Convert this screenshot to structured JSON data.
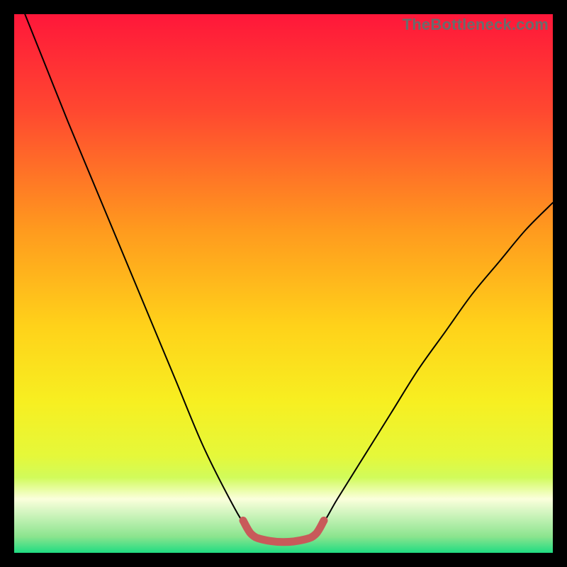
{
  "watermark": "TheBottleneck.com",
  "chart_data": {
    "type": "line",
    "title": "",
    "xlabel": "",
    "ylabel": "",
    "xlim": [
      0,
      100
    ],
    "ylim": [
      0,
      100
    ],
    "background_gradient": {
      "stops": [
        {
          "offset": 0.0,
          "color": "#ff173a"
        },
        {
          "offset": 0.18,
          "color": "#ff4830"
        },
        {
          "offset": 0.4,
          "color": "#ff9a1e"
        },
        {
          "offset": 0.58,
          "color": "#ffd21a"
        },
        {
          "offset": 0.72,
          "color": "#f7ef21"
        },
        {
          "offset": 0.82,
          "color": "#e5f83a"
        },
        {
          "offset": 0.86,
          "color": "#d1fb5a"
        },
        {
          "offset": 0.9,
          "color": "#fbffdc"
        },
        {
          "offset": 0.97,
          "color": "#8be48e"
        },
        {
          "offset": 1.0,
          "color": "#1fdc82"
        }
      ]
    },
    "series": [
      {
        "name": "bottleneck-curve",
        "color": "#000000",
        "width": 2,
        "points": [
          {
            "x": 2.0,
            "y": 100.0
          },
          {
            "x": 6.0,
            "y": 90.0
          },
          {
            "x": 10.0,
            "y": 80.0
          },
          {
            "x": 15.0,
            "y": 68.0
          },
          {
            "x": 20.0,
            "y": 56.0
          },
          {
            "x": 25.0,
            "y": 44.0
          },
          {
            "x": 30.0,
            "y": 32.0
          },
          {
            "x": 35.0,
            "y": 20.0
          },
          {
            "x": 40.0,
            "y": 10.0
          },
          {
            "x": 43.0,
            "y": 5.0
          },
          {
            "x": 46.0,
            "y": 2.5
          },
          {
            "x": 50.0,
            "y": 2.0
          },
          {
            "x": 54.0,
            "y": 2.5
          },
          {
            "x": 57.0,
            "y": 5.0
          },
          {
            "x": 60.0,
            "y": 10.0
          },
          {
            "x": 65.0,
            "y": 18.0
          },
          {
            "x": 70.0,
            "y": 26.0
          },
          {
            "x": 75.0,
            "y": 34.0
          },
          {
            "x": 80.0,
            "y": 41.0
          },
          {
            "x": 85.0,
            "y": 48.0
          },
          {
            "x": 90.0,
            "y": 54.0
          },
          {
            "x": 95.0,
            "y": 60.0
          },
          {
            "x": 100.0,
            "y": 65.0
          }
        ]
      },
      {
        "name": "optimal-region",
        "color": "#c85a5a",
        "width": 11,
        "points": [
          {
            "x": 42.5,
            "y": 6.0
          },
          {
            "x": 44.0,
            "y": 3.5
          },
          {
            "x": 46.0,
            "y": 2.5
          },
          {
            "x": 50.0,
            "y": 2.0
          },
          {
            "x": 54.0,
            "y": 2.5
          },
          {
            "x": 56.0,
            "y": 3.5
          },
          {
            "x": 57.5,
            "y": 6.0
          }
        ]
      }
    ]
  }
}
